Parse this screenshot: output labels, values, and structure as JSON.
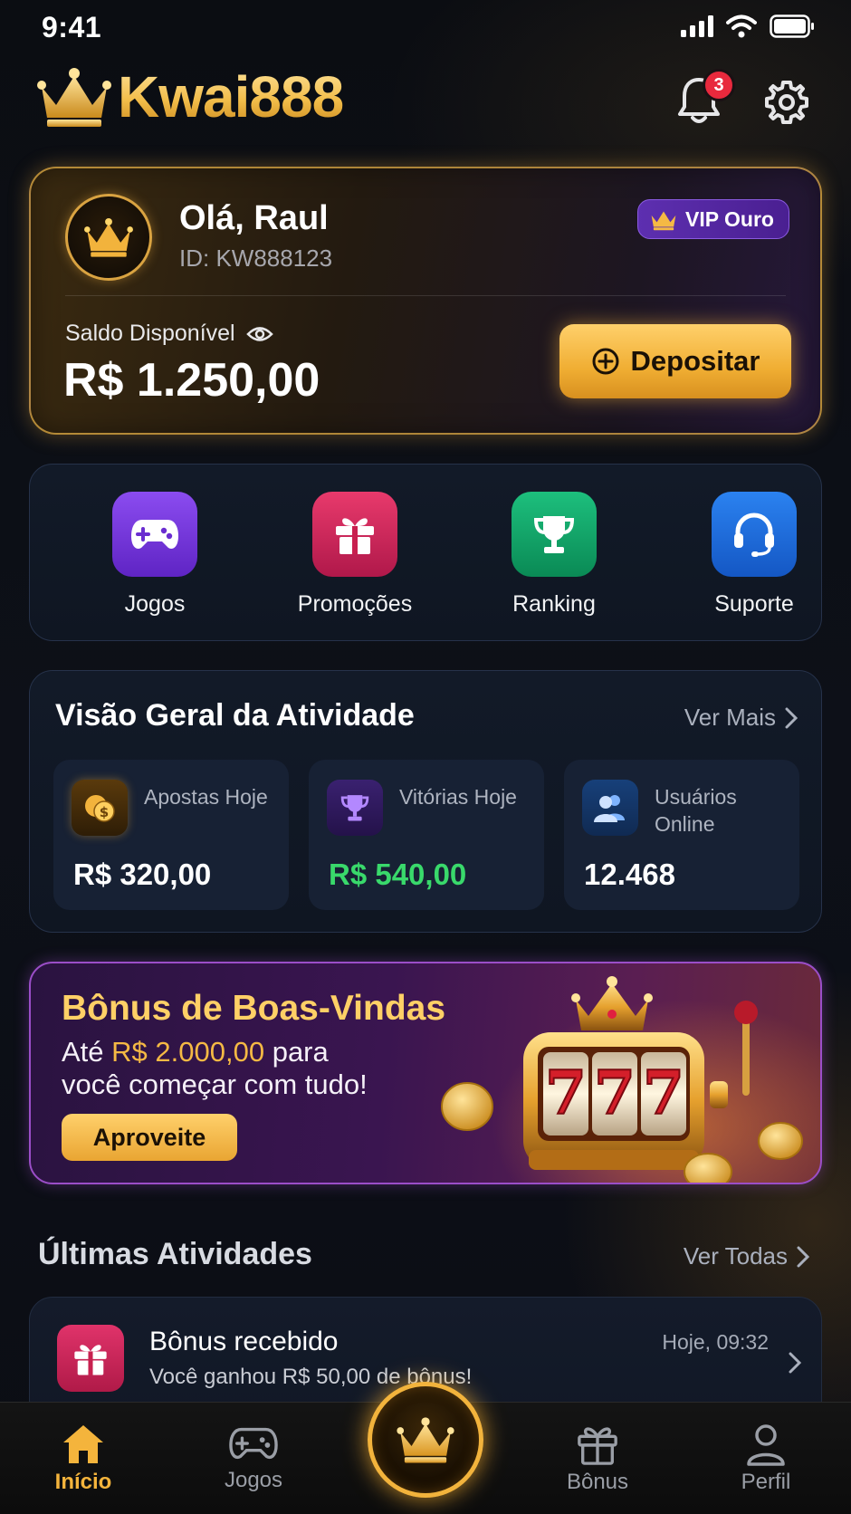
{
  "status_bar": {
    "time": "9:41"
  },
  "header": {
    "brand": "Kwai888",
    "notification_count": "3"
  },
  "account": {
    "greeting": "Olá, Raul",
    "user_id": "ID: KW888123",
    "vip_label": "VIP Ouro",
    "balance_label": "Saldo Disponível",
    "balance_value": "R$ 1.250,00",
    "deposit_label": "Depositar"
  },
  "quick_actions": [
    {
      "label": "Jogos",
      "icon": "gamepad-icon",
      "color": "#7b3fe4"
    },
    {
      "label": "Promoções",
      "icon": "gift-icon",
      "color": "#d62a5c"
    },
    {
      "label": "Ranking",
      "icon": "trophy-icon",
      "color": "#12a66b"
    },
    {
      "label": "Suporte",
      "icon": "headset-icon",
      "color": "#1f6fe0"
    }
  ],
  "overview": {
    "title": "Visão Geral da Atividade",
    "more_label": "Ver Mais",
    "stats": [
      {
        "label": "Apostas Hoje",
        "value": "R$ 320,00",
        "icon": "coins-icon",
        "value_color": "#ffffff"
      },
      {
        "label": "Vitórias Hoje",
        "value": "R$ 540,00",
        "icon": "trophy-icon",
        "value_color": "#39d96b"
      },
      {
        "label": "Usuários Online",
        "value": "12.468",
        "icon": "users-icon",
        "value_color": "#ffffff"
      }
    ]
  },
  "promo": {
    "title": "Bônus de Boas-Vindas",
    "subtitle_prefix": "Até",
    "subtitle_amount": "R$ 2.000,00",
    "subtitle_suffix": "para",
    "subtitle_line2": "você começar com tudo!",
    "button_label": "Aproveite",
    "slot_digits": [
      "7",
      "7",
      "7"
    ]
  },
  "latest": {
    "title": "Últimas Atividades",
    "more_label": "Ver Todas",
    "items": [
      {
        "title": "Bônus recebido",
        "subtitle": "Você ganhou R$ 50,00 de bônus!",
        "time": "Hoje, 09:32",
        "icon": "gift-icon"
      }
    ]
  },
  "nav": [
    {
      "label": "Início",
      "icon": "home-icon",
      "active": true
    },
    {
      "label": "Jogos",
      "icon": "gamepad-icon",
      "active": false
    },
    {
      "label": "Bônus",
      "icon": "gift-icon",
      "active": false
    },
    {
      "label": "Perfil",
      "icon": "user-icon",
      "active": false
    }
  ],
  "colors": {
    "gold": "#f2b33c",
    "accent_purple": "#7b3fe4",
    "win_green": "#39d96b",
    "badge_red": "#e8293d"
  }
}
